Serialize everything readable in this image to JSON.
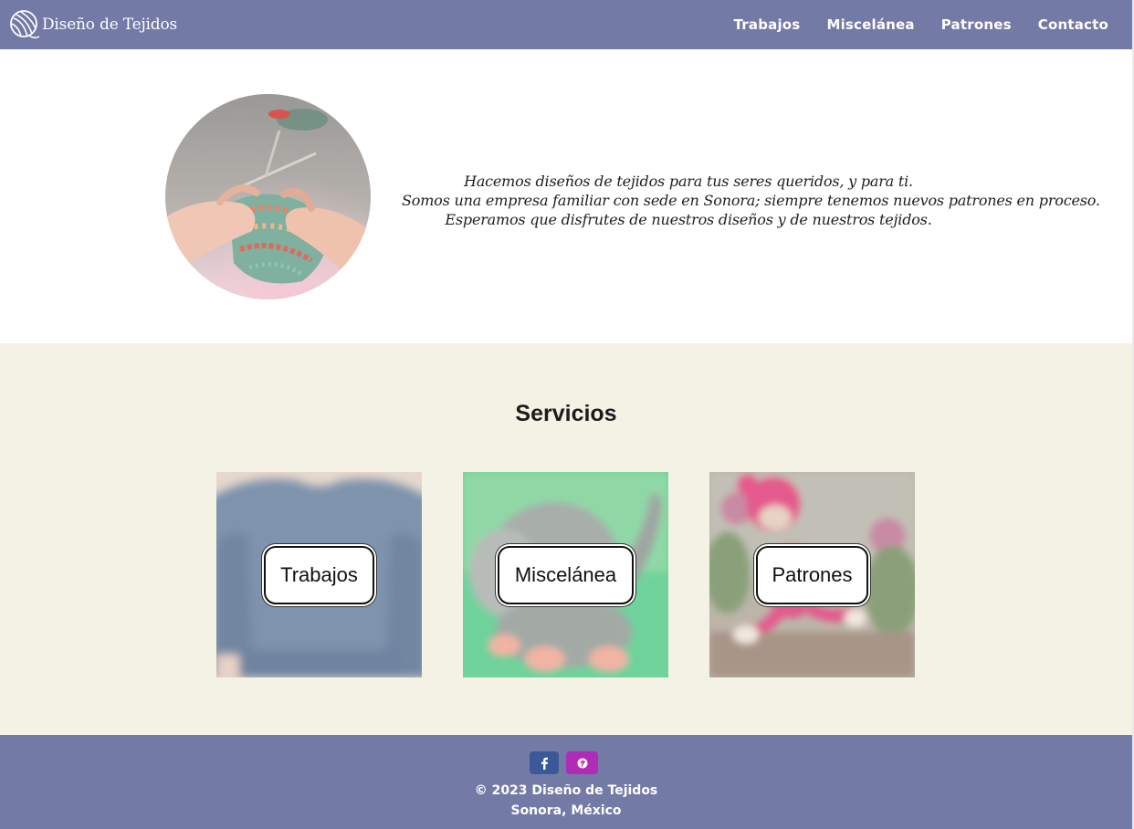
{
  "navbar": {
    "brand": "Diseño de Tejidos",
    "brand_icon": "yarn-ball-icon",
    "links": [
      "Trabajos",
      "Miscelánea",
      "Patrones",
      "Contacto"
    ]
  },
  "hero": {
    "lines": [
      "Hacemos diseños de tejidos para tus seres queridos, y para ti.",
      "Somos una empresa familiar con sede en Sonora; siempre tenemos nuevos patrones en proceso.",
      "Esperamos que disfrutes de nuestros diseños y de nuestros tejidos."
    ]
  },
  "services": {
    "title": "Servicios",
    "cards": [
      {
        "label": "Trabajos"
      },
      {
        "label": "Miscelánea"
      },
      {
        "label": "Patrones"
      }
    ]
  },
  "footer": {
    "social": [
      {
        "icon": "facebook-icon",
        "color": "#3b5998"
      },
      {
        "icon": "pinterest-icon",
        "color": "#b02cb6"
      }
    ],
    "copyright": "© 2023 Diseño de Tejidos",
    "location": "Sonora, México"
  },
  "colors": {
    "navbar": "#737aa6",
    "services_bg": "#f4f2e4",
    "footer": "#737aa6"
  }
}
